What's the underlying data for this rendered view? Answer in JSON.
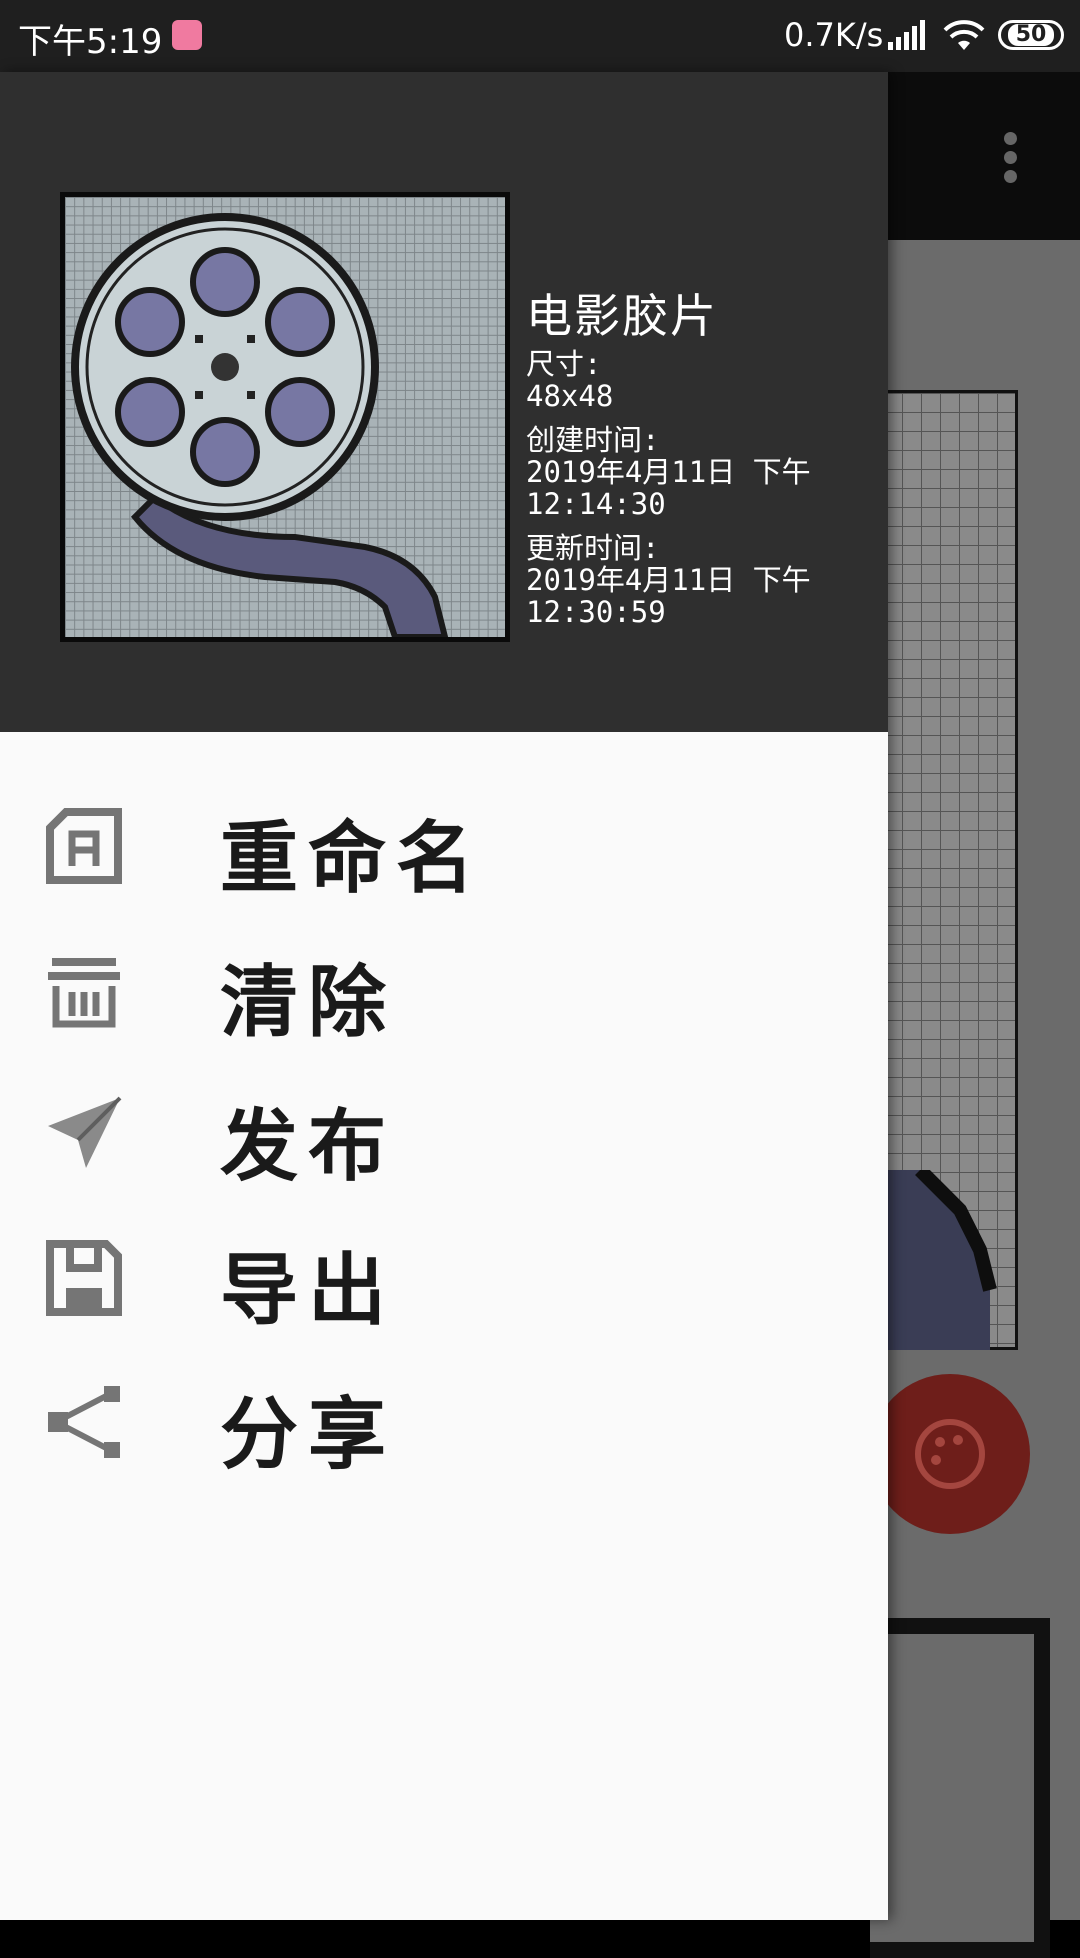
{
  "status_bar": {
    "time": "下午5:19",
    "network_speed": "0.7K/s",
    "battery": "50",
    "app_icon": "bilibili-icon"
  },
  "background": {
    "more_icon": "more-vert-icon",
    "fab_icon": "palette-icon"
  },
  "drawer": {
    "header": {
      "title": "电影胶片",
      "size_label": "尺寸:",
      "size_value": "48x48",
      "created_label": "创建时间:",
      "created_date": "2019年4月11日 下午",
      "created_time": "12:14:30",
      "updated_label": "更新时间:",
      "updated_date": "2019年4月11日 下午",
      "updated_time": "12:30:59"
    },
    "menu": [
      {
        "label": "重命名",
        "icon": "rename-icon"
      },
      {
        "label": "清除",
        "icon": "clear-icon"
      },
      {
        "label": "发布",
        "icon": "send-icon"
      },
      {
        "label": "导出",
        "icon": "save-icon"
      },
      {
        "label": "分享",
        "icon": "share-icon"
      }
    ]
  }
}
